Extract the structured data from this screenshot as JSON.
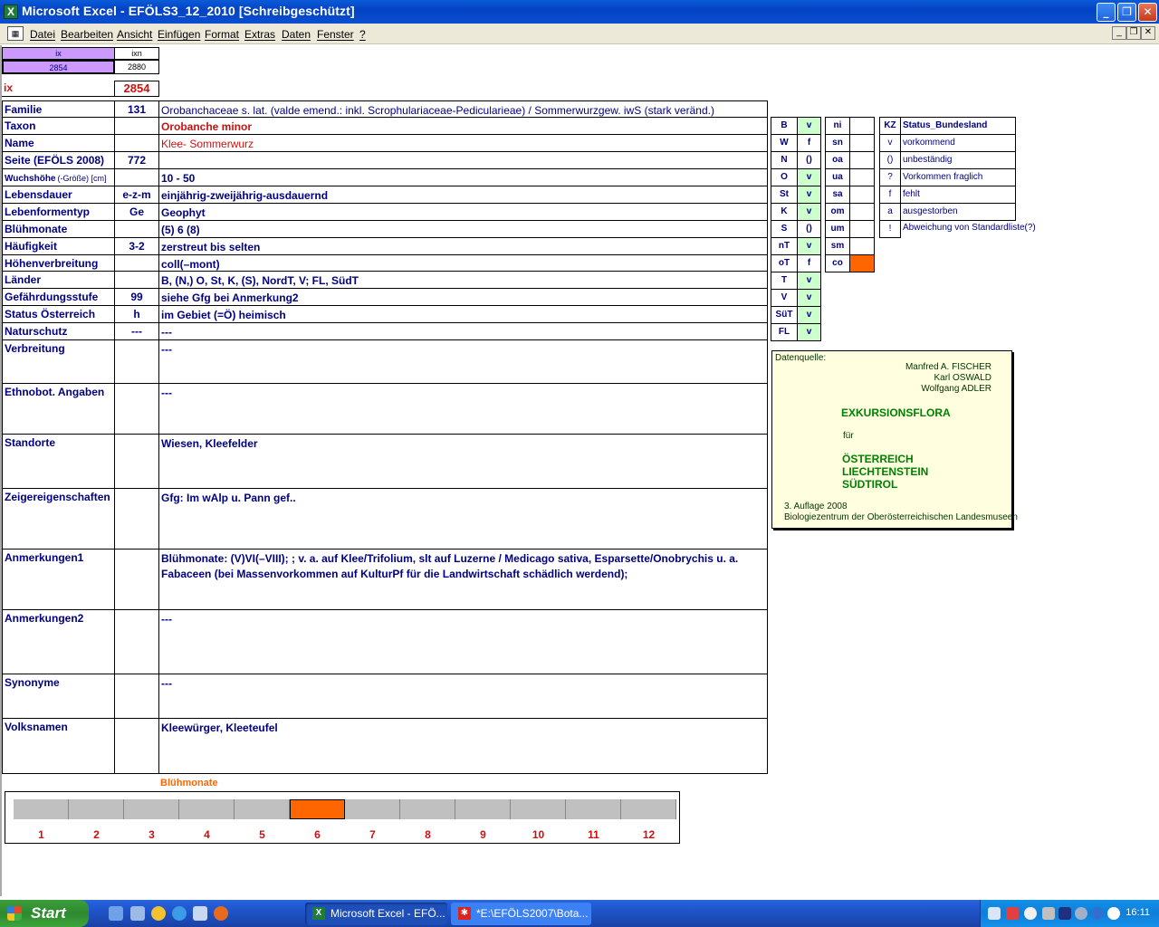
{
  "window": {
    "title": "Microsoft Excel - EFÖLS3_12_2010  [Schreibgeschützt]",
    "app_icon_glyph": "X",
    "buttons": [
      "minimize",
      "restore",
      "close"
    ]
  },
  "menu": {
    "items": [
      "Datei",
      "Bearbeiten",
      "Ansicht",
      "Einfügen",
      "Format",
      "Extras",
      "Daten",
      "Fenster",
      "?"
    ]
  },
  "index_box": {
    "col1_header": "ix",
    "col2_header": "ixn",
    "col1_value": "2854",
    "col2_value": "2880",
    "ix_label": "ix",
    "ix_value": "2854"
  },
  "fields": [
    {
      "label": "Familie",
      "mid": "131",
      "value": "Orobanchaceae s. lat. (valde emend.: inkl. Scrophulariaceae-Pedicularieae)  /  Sommerwurzgew. iwS (stark veränd.)"
    },
    {
      "label": "Taxon",
      "mid": "",
      "value": "Orobanche minor"
    },
    {
      "label": "Name",
      "mid": "",
      "value": "Klee- Sommerwurz"
    },
    {
      "label": "Seite (EFÖLS 2008)",
      "mid": "772",
      "value": ""
    },
    {
      "label": "Wuchshöhe",
      "label_small": "(-Größe) [cm]",
      "mid": "",
      "value": " 10 - 50"
    },
    {
      "label": "Lebensdauer",
      "mid": "e-z-m",
      "value": "einjährig-zweijährig-ausdauernd"
    },
    {
      "label": "Lebenformentyp",
      "mid": "Ge",
      "value": "Geophyt"
    },
    {
      "label": "Blühmonate",
      "mid": "",
      "value": "(5) 6 (8)"
    },
    {
      "label": "Häufigkeit",
      "mid": "3-2",
      "value": "zerstreut bis selten"
    },
    {
      "label": "Höhenverbreitung",
      "mid": "",
      "value": "coll(–mont)"
    },
    {
      "label": "Länder",
      "mid": "",
      "value": "B, (N,) O, St, K, (S), NordT, V; FL, SüdT"
    },
    {
      "label": "Gefährdungsstufe",
      "mid": "99",
      "value": "siehe Gfg bei Anmerkung2"
    },
    {
      "label": "Status Österreich",
      "mid": "h",
      "value": "im Gebiet (=Ö) heimisch"
    },
    {
      "label": "Naturschutz",
      "mid": "---",
      "value": "---"
    },
    {
      "label": "Verbreitung",
      "mid": "",
      "value": "---"
    },
    {
      "label": "Ethnobot. Angaben",
      "mid": "",
      "value": "---"
    },
    {
      "label": "Standorte",
      "mid": "",
      "value": "Wiesen, Kleefelder"
    },
    {
      "label": "Zeigereigenschaften",
      "mid": "",
      "value": "Gfg: Im wAlp u. Pann gef.."
    },
    {
      "label": "Anmerkungen1",
      "mid": "",
      "value": "Blühmonate: (V)VI(–VIII); ; v. a. auf Klee/Trifolium, slt auf Luzerne / Medicago sativa, Esparsette/Onobrychis u. a. Fabaceen (bei Massenvorkommen auf KulturPf für die Landwirtschaft schädlich werdend);"
    },
    {
      "label": "Anmerkungen2",
      "mid": "",
      "value": "---"
    },
    {
      "label": "Synonyme",
      "mid": "",
      "value": "---"
    },
    {
      "label": "Volksnamen",
      "mid": "",
      "value": "Kleewürger, Kleeteufel"
    }
  ],
  "states": [
    {
      "code": "B",
      "status": "v"
    },
    {
      "code": "W",
      "status": "f"
    },
    {
      "code": "N",
      "status": "()"
    },
    {
      "code": "O",
      "status": "v"
    },
    {
      "code": "St",
      "status": "v"
    },
    {
      "code": "K",
      "status": "v"
    },
    {
      "code": "S",
      "status": "()"
    },
    {
      "code": "nT",
      "status": "v"
    },
    {
      "code": "oT",
      "status": "f"
    },
    {
      "code": "T",
      "status": "v"
    },
    {
      "code": "V",
      "status": "v"
    },
    {
      "code": "SüT",
      "status": "v"
    },
    {
      "code": "FL",
      "status": "v"
    }
  ],
  "height_levels": [
    {
      "code": "ni",
      "fill": ""
    },
    {
      "code": "sn",
      "fill": ""
    },
    {
      "code": "oa",
      "fill": ""
    },
    {
      "code": "ua",
      "fill": ""
    },
    {
      "code": "sa",
      "fill": ""
    },
    {
      "code": "om",
      "fill": ""
    },
    {
      "code": "um",
      "fill": ""
    },
    {
      "code": "sm",
      "fill": ""
    },
    {
      "code": "co",
      "fill": "#ff6600"
    }
  ],
  "kz_legend": {
    "header_code": "KZ",
    "header_desc": "Status_Bundesland",
    "rows": [
      {
        "code": "v",
        "desc": "vorkommend"
      },
      {
        "code": "()",
        "desc": "unbeständig"
      },
      {
        "code": "?",
        "desc": "Vorkommen fraglich"
      },
      {
        "code": "f",
        "desc": "fehlt"
      },
      {
        "code": "a",
        "desc": "ausgestorben"
      },
      {
        "code": "!",
        "desc": "Abweichung von Standardliste(?)"
      }
    ]
  },
  "source": {
    "label": "Datenquelle:",
    "authors": [
      "Manfred A. FISCHER",
      "Karl OSWALD",
      "Wolfgang ADLER"
    ],
    "book_title": "EXKURSIONSFLORA",
    "for": "für",
    "regions": [
      "ÖSTERREICH",
      "LIECHTENSTEIN",
      "SÜDTIROL"
    ],
    "edition": "3. Auflage 2008",
    "publisher": "Biologiezentrum der Oberösterreichischen Landesmuseen"
  },
  "bloom": {
    "title": "Blühmonate",
    "months": [
      "1",
      "2",
      "3",
      "4",
      "5",
      "6",
      "7",
      "8",
      "9",
      "10",
      "11",
      "12"
    ],
    "active": [
      false,
      false,
      false,
      false,
      false,
      true,
      false,
      false,
      false,
      false,
      false,
      false
    ],
    "active_color": "#ff6600"
  },
  "taskbar": {
    "start": "Start",
    "tasks": [
      "Microsoft Excel - EFÖ...",
      "*E:\\EFÖLS2007\\Bota..."
    ],
    "clock": "16:11"
  }
}
